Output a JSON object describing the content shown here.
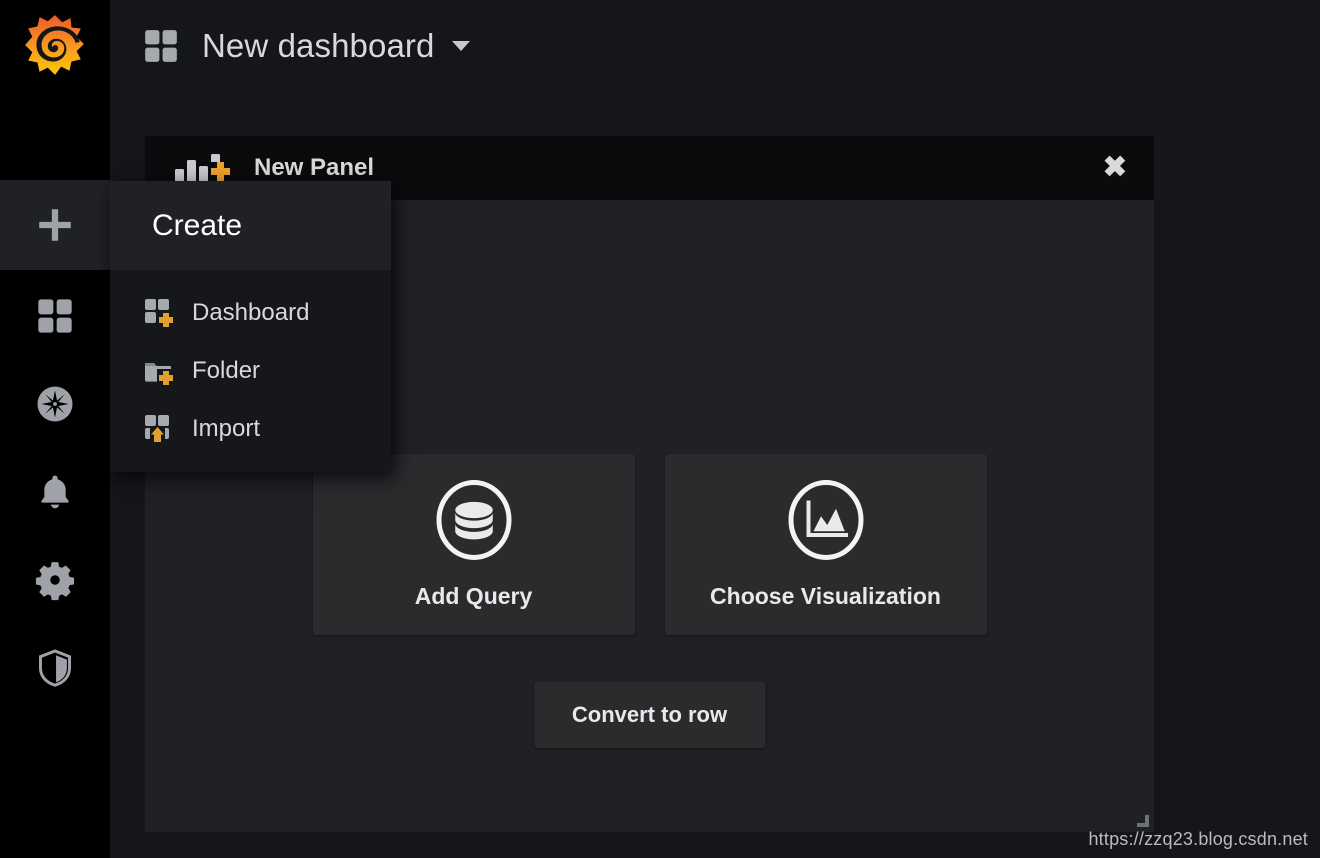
{
  "app": {
    "logo_icon": "grafana-logo-icon",
    "brand_color": "#f05a28",
    "brand_color_2": "#fbca04",
    "background": "#141619"
  },
  "sidebar": {
    "items": [
      {
        "id": "create",
        "icon": "plus-icon",
        "label": "Create",
        "active": true
      },
      {
        "id": "dashboards",
        "icon": "dashboards-icon",
        "label": "Dashboards",
        "active": false
      },
      {
        "id": "explore",
        "icon": "compass-icon",
        "label": "Explore",
        "active": false
      },
      {
        "id": "alerting",
        "icon": "bell-icon",
        "label": "Alerting",
        "active": false
      },
      {
        "id": "configuration",
        "icon": "gear-icon",
        "label": "Configuration",
        "active": false
      },
      {
        "id": "server-admin",
        "icon": "shield-icon",
        "label": "Server Admin",
        "active": false
      }
    ]
  },
  "topbar": {
    "dashboard_icon": "dashboard-grid-icon",
    "title": "New dashboard",
    "caret_icon": "chevron-down-icon"
  },
  "panel": {
    "header_icon": "add-panel-icon",
    "title": "New Panel",
    "close_label": "✖",
    "close_icon": "close-icon",
    "cards": [
      {
        "id": "add-query",
        "icon": "database-icon",
        "label": "Add Query"
      },
      {
        "id": "choose-visualization",
        "icon": "image-chart-icon",
        "label": "Choose Visualization"
      }
    ],
    "convert_button": "Convert to row",
    "resize_handle_icon": "resize-grip-icon",
    "body_color": "#202124",
    "header_color": "#0a0b0c",
    "card_color": "#2b2b2e"
  },
  "create_menu": {
    "header": "Create",
    "items": [
      {
        "id": "dashboard",
        "icon": "dashboard-plus-icon",
        "label": "Dashboard"
      },
      {
        "id": "folder",
        "icon": "folder-plus-icon",
        "label": "Folder"
      },
      {
        "id": "import",
        "icon": "import-icon",
        "label": "Import"
      }
    ],
    "accent_color": "#e0a030"
  },
  "watermark": {
    "text": "https://zzq23.blog.csdn.net"
  }
}
